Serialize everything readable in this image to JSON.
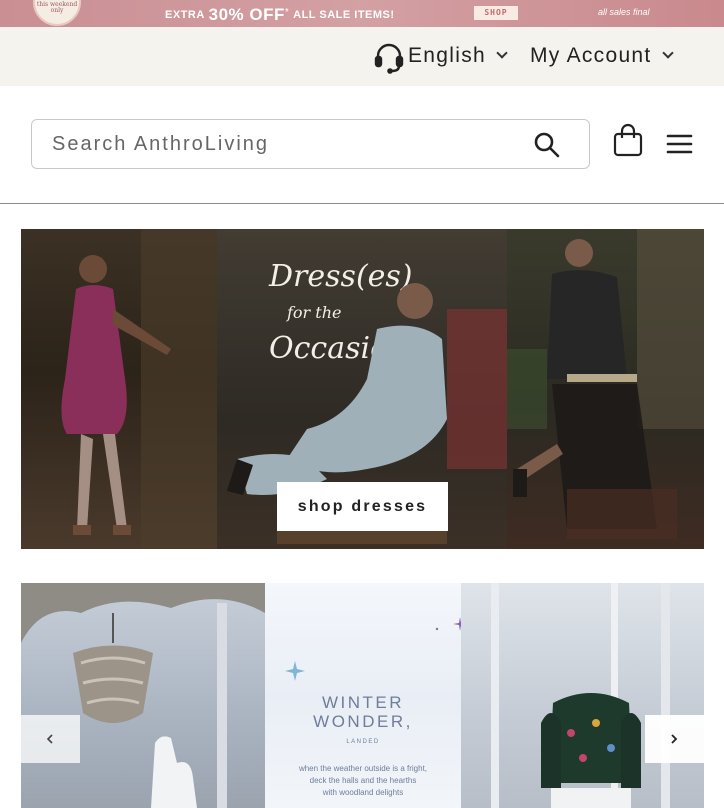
{
  "promo": {
    "badge": "this weekend only",
    "pre": "EXTRA",
    "offer": "30% OFF",
    "offer_mark": "*",
    "post": "ALL SALE ITEMS!",
    "shop_label": "SHOP",
    "fine_print": "all sales final",
    "colors": {
      "background": "#d09a9e",
      "text": "#ffffff"
    }
  },
  "utility": {
    "headset_icon": "headset-icon",
    "language": "English",
    "account": "My Account"
  },
  "header": {
    "search_placeholder": "Search AnthroLiving",
    "search_icon": "search-icon",
    "bag_icon": "shopping-bag-icon",
    "menu_icon": "hamburger-menu-icon"
  },
  "hero": {
    "headline_1": "Dress(es)",
    "headline_2": "for the",
    "headline_3": "Occasion",
    "cta_label": "shop dresses"
  },
  "carousel": {
    "title_1": "WINTER",
    "title_2": "WONDER,",
    "subtitle": "LANDED",
    "body_1": "when the weather outside is a fright,",
    "body_2": "deck the halls and the hearths",
    "body_3": "with woodland delights",
    "prev_icon": "chevron-left-icon",
    "next_icon": "chevron-right-icon"
  }
}
